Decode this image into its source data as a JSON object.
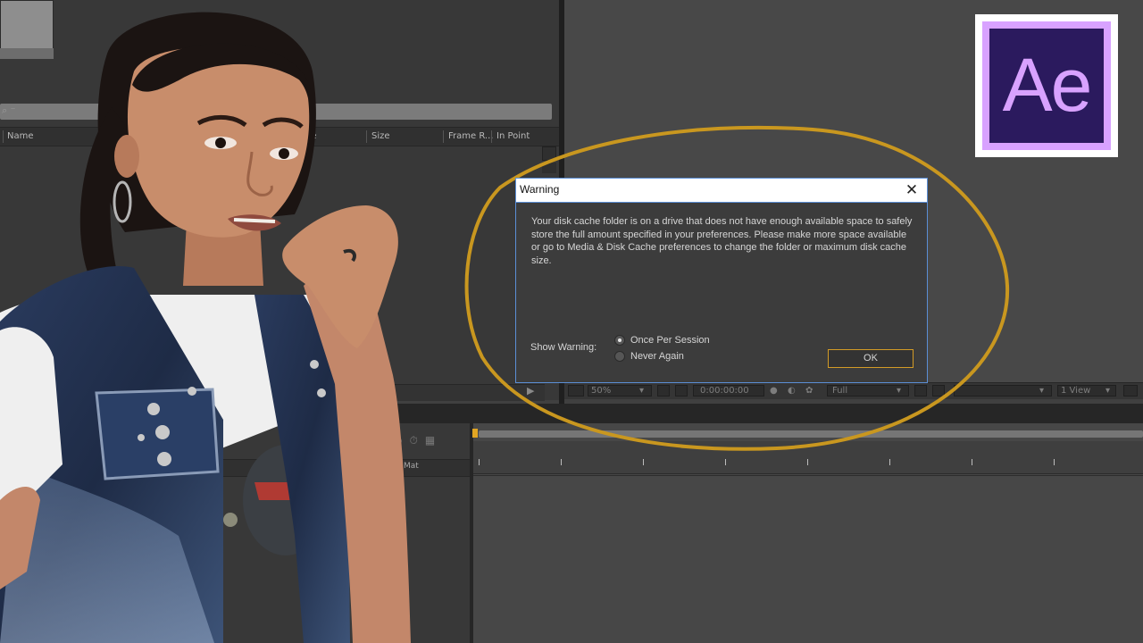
{
  "project_panel": {
    "search_glyph": "⌕ ⁻",
    "columns": [
      "Name",
      "ype",
      "Size",
      "Frame R...",
      "In Point"
    ]
  },
  "comp_footer": {
    "zoom": "50%",
    "timecode": "0:00:00:00",
    "resolution": "Full",
    "views": "1 View"
  },
  "timeline": {
    "column_mat": "Mat"
  },
  "logo": {
    "text": "Ae",
    "colors": {
      "outer": "#ffffff",
      "frame": "#d8a2ff",
      "fill": "#2b1a5e"
    }
  },
  "dialog": {
    "title": "Warning",
    "close_icon": "close-icon",
    "message": "Your disk cache folder is on a drive that does not have enough available space to safely store the full amount specified in your preferences. Please make more space available or go to Media & Disk Cache preferences to change the folder or maximum disk cache size.",
    "show_warning_label": "Show Warning:",
    "options": [
      {
        "label": "Once Per Session",
        "selected": true
      },
      {
        "label": "Never Again",
        "selected": false
      }
    ],
    "ok_label": "OK"
  },
  "colors": {
    "highlight_ring": "#c9971f",
    "dialog_border": "#5b8fd6",
    "ok_border": "#d39b26",
    "time_marker": "#e2a623"
  }
}
